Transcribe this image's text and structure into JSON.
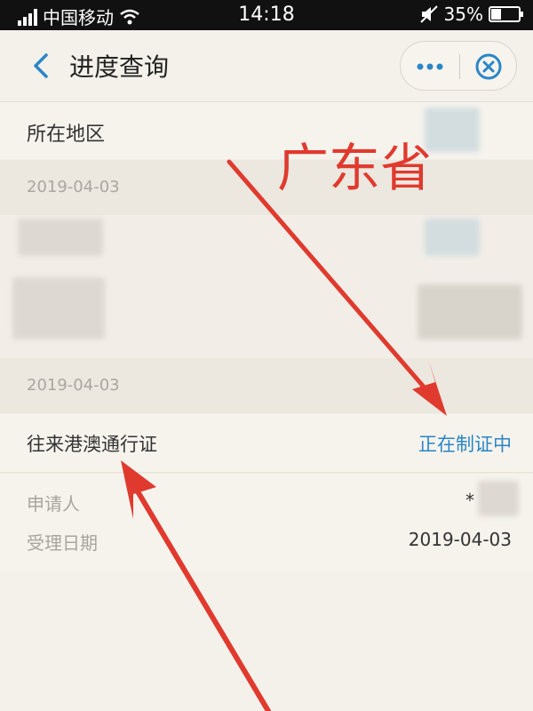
{
  "status_bar": {
    "carrier": "中国移动",
    "time": "14:18",
    "battery": "35%",
    "battery_level": 0.35
  },
  "nav": {
    "title": "进度查询",
    "more_icon": "more-dots-icon",
    "close_icon": "close-circle-icon"
  },
  "region": {
    "label": "所在地区"
  },
  "groups": [
    {
      "date": "2019-04-03"
    },
    {
      "date": "2019-04-03"
    }
  ],
  "item": {
    "name": "往来港澳通行证",
    "status": "正在制证中"
  },
  "details": [
    {
      "label": "申请人",
      "value": "*"
    },
    {
      "label": "受理日期",
      "value": "2019-04-03"
    }
  ],
  "annotation": {
    "text": "广东省",
    "color": "#e03a2e"
  },
  "colors": {
    "accent": "#2a86c7",
    "arrow": "#e03a2e"
  }
}
